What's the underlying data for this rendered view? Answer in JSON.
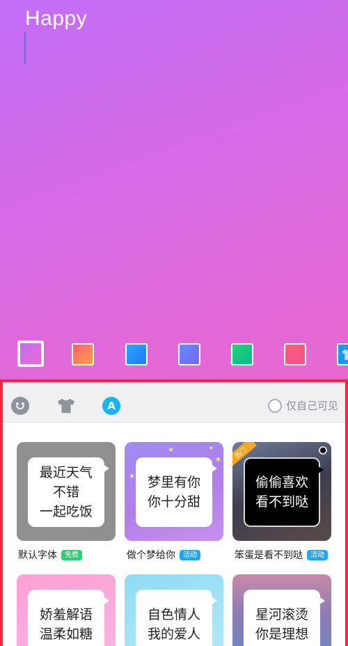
{
  "editor": {
    "text": "Happy"
  },
  "palette": {
    "swatches": [
      {
        "name": "purple-pink",
        "selected": true
      },
      {
        "name": "orange-red"
      },
      {
        "name": "blue"
      },
      {
        "name": "indigo"
      },
      {
        "name": "green"
      },
      {
        "name": "rose"
      },
      {
        "name": "skin",
        "icon": "shirt-icon"
      }
    ]
  },
  "tabs": {
    "emoji_icon": "emoji-icon",
    "skin_icon": "shirt-icon",
    "font_icon_letter": "A",
    "only_me_label": "仅自己可见"
  },
  "fonts": [
    {
      "lines": [
        "最近天气",
        "不错",
        "一起吃饭"
      ],
      "caption": "默认字体",
      "badge": "免费"
    },
    {
      "lines": [
        "梦里有你",
        "你十分甜"
      ],
      "caption": "做个梦给你",
      "badge": "活动"
    },
    {
      "lines": [
        "偷偷喜欢",
        "看不到哒"
      ],
      "caption": "笨蛋是看不到哒",
      "badge": "活动",
      "corner": "热门"
    },
    {
      "lines": [
        "娇羞解语",
        "温柔如糖"
      ]
    },
    {
      "lines": [
        "自色情人",
        "我的爱人"
      ]
    },
    {
      "lines": [
        "星河滚烫",
        "你是理想"
      ]
    }
  ],
  "colors": {
    "highlight_border": "#f0283c",
    "accent_blue": "#18b4f0",
    "free_green": "#2dcf72"
  }
}
